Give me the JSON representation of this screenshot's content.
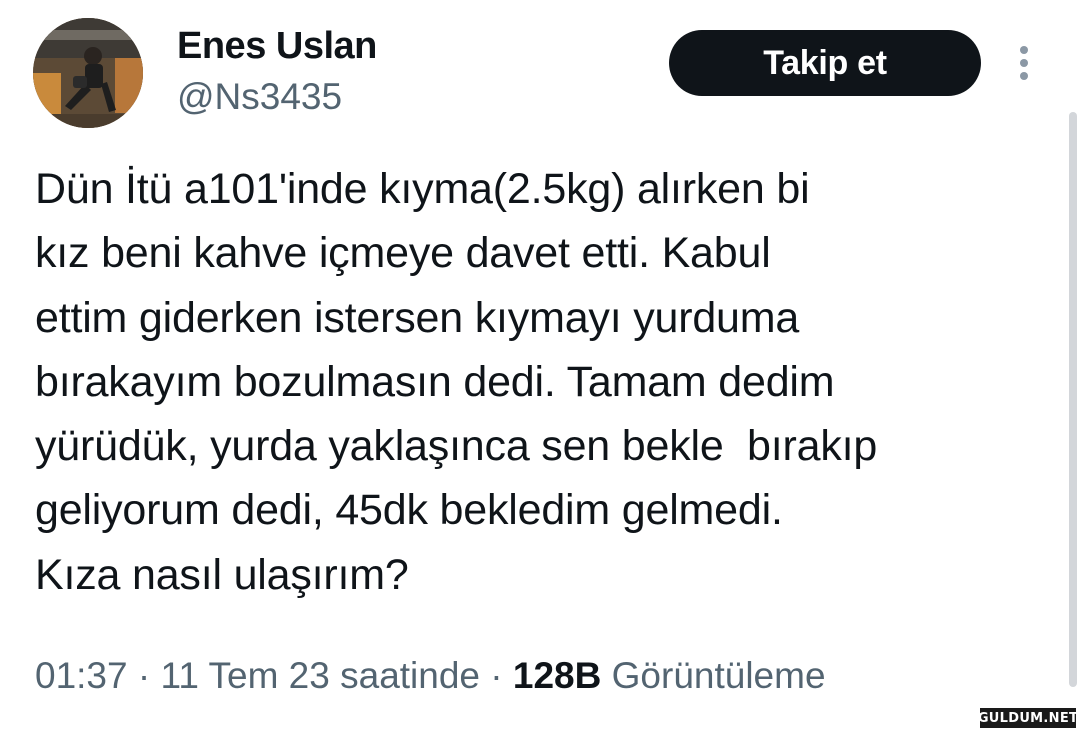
{
  "user": {
    "display_name": "Enes Uslan",
    "handle": "@Ns3435",
    "avatar_icon": "profile-photo"
  },
  "actions": {
    "follow_label": "Takip et",
    "more_icon": "more-vertical-icon"
  },
  "tweet": {
    "lines": [
      "Dün İtü a101'inde kıyma(2.5kg) alırken bi",
      "kız beni kahve içmeye davet etti. Kabul",
      "ettim giderken istersen kıymayı yurduma",
      "bırakayım bozulmasın dedi. Tamam dedim",
      "yürüdük, yurda yaklaşınca sen bekle  bırakıp",
      "geliyorum dedi, 45dk bekledim gelmedi.",
      "Kıza nasıl ulaşırım?"
    ]
  },
  "meta": {
    "time": "01:37",
    "date": "11 Tem 23 saatinde",
    "separator": " · ",
    "views_count": "128B",
    "views_label": "Görüntüleme"
  },
  "watermark": {
    "text": "GULDUM.NET"
  },
  "colors": {
    "text_primary": "#0f1419",
    "text_secondary": "#536471",
    "button_bg": "#0f1419",
    "button_text": "#ffffff"
  }
}
